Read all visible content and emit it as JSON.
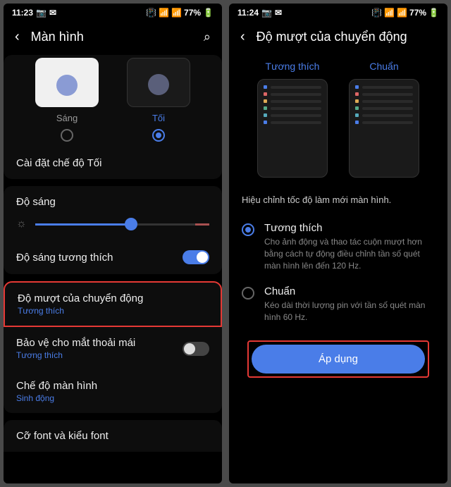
{
  "left": {
    "status": {
      "time": "11:23",
      "battery": "77%"
    },
    "header": {
      "title": "Màn hình"
    },
    "theme": {
      "light_label": "Sáng",
      "dark_label": "Tối"
    },
    "dark_settings": "Cài đặt chế độ Tối",
    "brightness": {
      "label": "Độ sáng"
    },
    "adaptive_brightness": "Độ sáng tương thích",
    "motion": {
      "title": "Độ mượt của chuyển động",
      "sub": "Tương thích"
    },
    "eye_comfort": {
      "title": "Bảo vệ cho mắt thoải mái",
      "sub": "Tương thích"
    },
    "screen_mode": {
      "title": "Chế độ màn hình",
      "sub": "Sinh động"
    },
    "font": "Cỡ font và kiểu font"
  },
  "right": {
    "status": {
      "time": "11:24",
      "battery": "77%"
    },
    "header": {
      "title": "Độ mượt của chuyển động"
    },
    "labels": {
      "adaptive": "Tương thích",
      "standard": "Chuẩn"
    },
    "description": "Hiệu chỉnh tốc độ làm mới màn hình.",
    "option_adaptive": {
      "title": "Tương thích",
      "desc": "Cho ảnh động và thao tác cuộn mượt hơn bằng cách tự động điều chỉnh tần số quét màn hình lên đến 120 Hz."
    },
    "option_standard": {
      "title": "Chuẩn",
      "desc": "Kéo dài thời lượng pin với tần số quét màn hình 60 Hz."
    },
    "apply": "Áp dụng"
  }
}
